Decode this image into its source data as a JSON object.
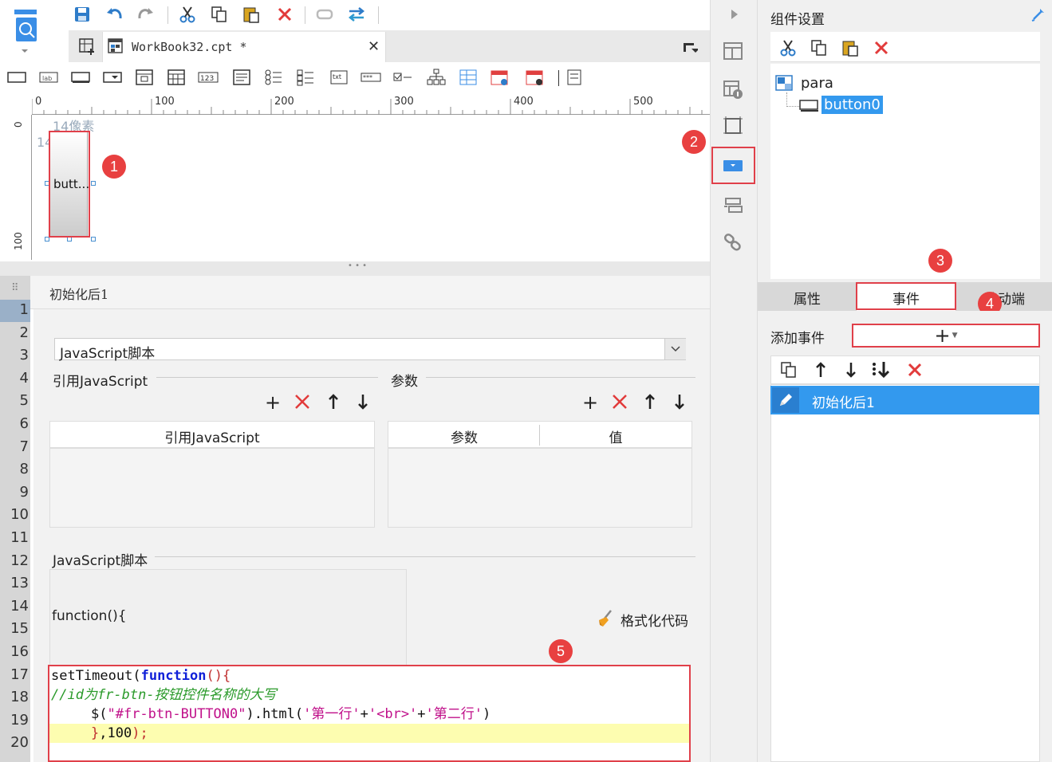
{
  "toolbar": {
    "tab_title": "WorkBook32.cpt *"
  },
  "ruler": {
    "h_ticks": [
      "0",
      "100",
      "200",
      "300",
      "400",
      "500"
    ],
    "v_ticks": [
      "0",
      "100"
    ]
  },
  "canvas": {
    "label_top": "14像素",
    "label_left": "14像素",
    "button_text": "butt..."
  },
  "editor": {
    "event_title": "初始化后1",
    "script_type": "JavaScript脚本",
    "ref_js_label": "引用JavaScript",
    "params_label": "参数",
    "ref_js_col": "引用JavaScript",
    "param_col": "参数",
    "value_col": "值",
    "script_section": "JavaScript脚本",
    "func_header": "function(){",
    "format_code": "格式化代码",
    "code": {
      "l1a": "setTimeout(",
      "l1b": "function",
      "l1c": "(){",
      "l2": "//id为fr-btn-按钮控件名称的大写",
      "l3a": "$(",
      "l3b": "\"#fr-btn-BUTTON0\"",
      "l3c": ").html(",
      "l3d": "'第一行'",
      "l3e": "+",
      "l3f": "'<br>'",
      "l3g": "+",
      "l3h": "'第二行'",
      "l3i": ")",
      "l4a": "}",
      "l4b": ",100",
      "l4c": ");"
    }
  },
  "gutter": {
    "rows": [
      "1",
      "2",
      "3",
      "4",
      "5",
      "6",
      "7",
      "8",
      "9",
      "10",
      "11",
      "12",
      "13",
      "14",
      "15",
      "16",
      "17",
      "18",
      "19",
      "20"
    ]
  },
  "right_panel": {
    "title": "组件设置",
    "tree_root": "para",
    "tree_child": "button0",
    "tabs": {
      "attr": "属性",
      "event": "事件",
      "mobile": "移动端"
    },
    "add_event_label": "添加事件",
    "event_item": "初始化后1"
  },
  "annotations": {
    "b1": "1",
    "b2": "2",
    "b3": "3",
    "b4": "4",
    "b5": "5"
  },
  "colors": {
    "accent": "#3a8ee6",
    "selection": "#3399ee",
    "annotation_red": "#e84040",
    "panel_bg": "#f0f0f0"
  }
}
